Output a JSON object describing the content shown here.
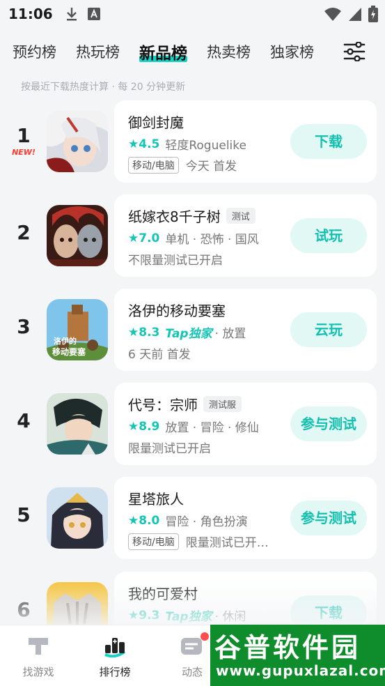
{
  "status_bar": {
    "time": "11:06"
  },
  "tabs": [
    {
      "label": "预约榜",
      "active": false
    },
    {
      "label": "热玩榜",
      "active": false
    },
    {
      "label": "新品榜",
      "active": true
    },
    {
      "label": "热卖榜",
      "active": false
    },
    {
      "label": "独家榜",
      "active": false
    }
  ],
  "subtitle": "按最近下载热度计算 · 每 20 分钟更新",
  "items": [
    {
      "rank": "1",
      "badge": "NEW!",
      "title": "御剑封魔",
      "tag": "",
      "score": "★4.5",
      "tap": "",
      "meta": "轻度Roguelike",
      "platform": "移动/电脑",
      "line3": "今天 首发",
      "button": "下载"
    },
    {
      "rank": "2",
      "badge": "",
      "title": "纸嫁衣8千子树",
      "tag": "测试",
      "score": "★7.0",
      "tap": "",
      "meta": "单机 · 恐怖 · 国风",
      "platform": "",
      "line3": "不限量测试已开启",
      "button": "试玩"
    },
    {
      "rank": "3",
      "badge": "",
      "title": "洛伊的移动要塞",
      "tag": "",
      "score": "★8.3",
      "tap": "Tap独家",
      "meta": "· 放置",
      "platform": "",
      "line3": "6 天前 首发",
      "button": "云玩"
    },
    {
      "rank": "4",
      "badge": "",
      "title": "代号：宗师",
      "tag": "测试服",
      "score": "★8.9",
      "tap": "",
      "meta": "放置 · 冒险 · 修仙",
      "platform": "",
      "line3": "限量测试已开启",
      "button": "参与测试"
    },
    {
      "rank": "5",
      "badge": "",
      "title": "星塔旅人",
      "tag": "",
      "score": "★8.0",
      "tap": "",
      "meta": "冒险 · 角色扮演",
      "platform": "移动/电脑",
      "line3": "限量测试已开…",
      "button": "参与测试"
    },
    {
      "rank": "6",
      "badge": "",
      "title": "我的可爱村",
      "tag": "",
      "score": "★9.3",
      "tap": "Tap独家",
      "meta": "· 休闲",
      "platform": "",
      "line3": "",
      "button": "下载"
    }
  ],
  "bottom_nav": [
    {
      "label": "找游戏",
      "icon": "gamepad-icon",
      "active": false
    },
    {
      "label": "排行榜",
      "icon": "leaderboard-icon",
      "active": true
    },
    {
      "label": "动态",
      "icon": "feed-icon",
      "active": false
    }
  ],
  "watermark": {
    "title": "谷普软件园",
    "url": "www.gupuxlazal.com"
  },
  "colors": {
    "accent": "#17d3c5",
    "button_bg": "#e2f8f5",
    "button_text": "#13bfae",
    "new_badge": "#ff3b30",
    "watermark_bg": "#0f8d2c"
  }
}
